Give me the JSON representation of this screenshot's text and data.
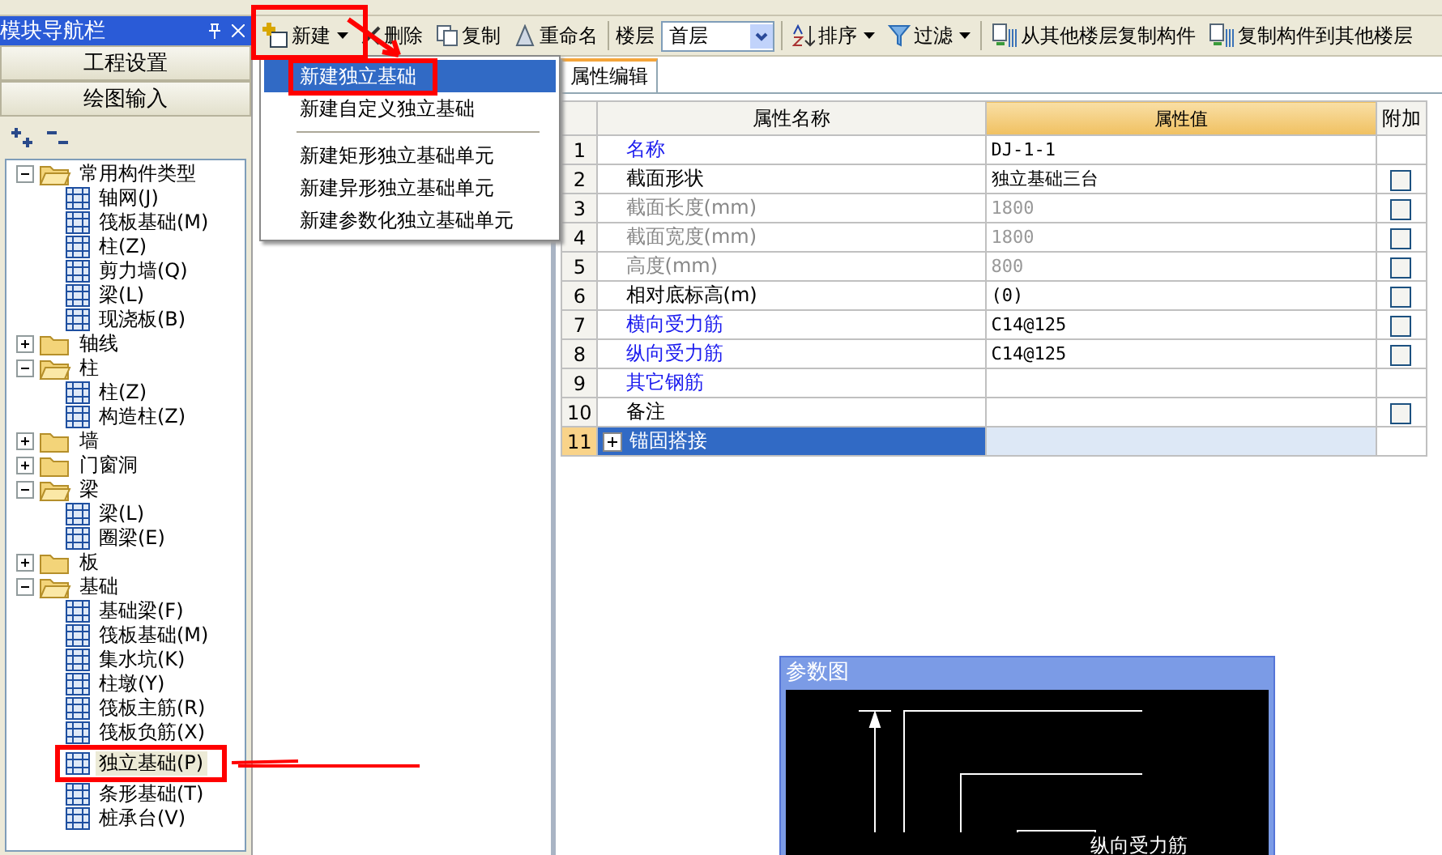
{
  "navigator": {
    "title": "模块导航栏",
    "buttons": [
      "工程设置",
      "绘图输入"
    ],
    "tree": [
      {
        "label": "常用构件类型",
        "expanded": true,
        "selected": false,
        "children": [
          {
            "label": "轴网(J)",
            "selected": false
          },
          {
            "label": "筏板基础(M)",
            "selected": false
          },
          {
            "label": "柱(Z)",
            "selected": false
          },
          {
            "label": "剪力墙(Q)",
            "selected": false
          },
          {
            "label": "梁(L)",
            "selected": false
          },
          {
            "label": "现浇板(B)",
            "selected": false
          }
        ]
      },
      {
        "label": "轴线",
        "expanded": false,
        "selected": false
      },
      {
        "label": "柱",
        "expanded": true,
        "selected": false,
        "children": [
          {
            "label": "柱(Z)",
            "selected": false
          },
          {
            "label": "构造柱(Z)",
            "selected": false
          }
        ]
      },
      {
        "label": "墙",
        "expanded": false,
        "selected": false
      },
      {
        "label": "门窗洞",
        "expanded": false,
        "selected": false
      },
      {
        "label": "梁",
        "expanded": true,
        "selected": false,
        "children": [
          {
            "label": "梁(L)",
            "selected": false
          },
          {
            "label": "圈梁(E)",
            "selected": false
          }
        ]
      },
      {
        "label": "板",
        "expanded": false,
        "selected": false
      },
      {
        "label": "基础",
        "expanded": true,
        "selected": false,
        "children": [
          {
            "label": "基础梁(F)",
            "selected": false
          },
          {
            "label": "筏板基础(M)",
            "selected": false
          },
          {
            "label": "集水坑(K)",
            "selected": false
          },
          {
            "label": "柱墩(Y)",
            "selected": false
          },
          {
            "label": "筏板主筋(R)",
            "selected": false
          },
          {
            "label": "筏板负筋(X)",
            "selected": false
          },
          {
            "label": "独立基础(P)",
            "selected": true
          },
          {
            "label": "条形基础(T)",
            "selected": false
          },
          {
            "label": "桩承台(V)",
            "selected": false
          }
        ]
      }
    ]
  },
  "toolbar": {
    "new_button": "新建",
    "delete_button": "删除",
    "copy_button": "复制",
    "rename_button": "重命名",
    "floor_label": "楼层",
    "floor_value": "首层",
    "sort_button": "排序",
    "filter_button": "过滤",
    "copy_from_button": "从其他楼层复制构件",
    "copy_to_button": "复制构件到其他楼层"
  },
  "new_menu": {
    "groups": [
      [
        {
          "label": "新建独立基础",
          "selected": true
        },
        {
          "label": "新建自定义独立基础",
          "selected": false
        }
      ],
      [
        {
          "label": "新建矩形独立基础单元",
          "selected": false
        },
        {
          "label": "新建异形独立基础单元",
          "selected": false
        },
        {
          "label": "新建参数化独立基础单元",
          "selected": false
        }
      ]
    ]
  },
  "properties": {
    "tab": "属性编辑",
    "columns": [
      "属性名称",
      "属性值",
      "附加"
    ],
    "rows": [
      {
        "no": "1",
        "name": "名称",
        "kind": "link",
        "value": "DJ-1-1",
        "selected": false
      },
      {
        "no": "2",
        "name": "截面形状",
        "kind": "plain",
        "value": "独立基础三台",
        "checkbox": {
          "checked": false
        },
        "selected": false
      },
      {
        "no": "3",
        "name": "截面长度(mm)",
        "kind": "disabled",
        "value": "1800",
        "checkbox": {
          "checked": false
        },
        "selected": false
      },
      {
        "no": "4",
        "name": "截面宽度(mm)",
        "kind": "disabled",
        "value": "1800",
        "checkbox": {
          "checked": false
        },
        "selected": false
      },
      {
        "no": "5",
        "name": "高度(mm)",
        "kind": "disabled",
        "value": "800",
        "checkbox": {
          "checked": false
        },
        "selected": false
      },
      {
        "no": "6",
        "name": "相对底标高(m)",
        "kind": "plain",
        "value": "(0)",
        "checkbox": {
          "checked": false
        },
        "selected": false
      },
      {
        "no": "7",
        "name": "横向受力筋",
        "kind": "link",
        "value": "C14@125",
        "checkbox": {
          "checked": false
        },
        "selected": false
      },
      {
        "no": "8",
        "name": "纵向受力筋",
        "kind": "link",
        "value": "C14@125",
        "checkbox": {
          "checked": false
        },
        "selected": false
      },
      {
        "no": "9",
        "name": "其它钢筋",
        "kind": "link",
        "value": "",
        "selected": false
      },
      {
        "no": "10",
        "name": "备注",
        "kind": "plain",
        "value": "",
        "checkbox": {
          "checked": false
        },
        "selected": false
      },
      {
        "no": "11",
        "name": "锚固搭接",
        "kind": "group",
        "expanded": false,
        "value": "",
        "selected": true
      }
    ]
  },
  "parameter_figure": {
    "title": "参数图",
    "label": "纵向受力筋"
  }
}
